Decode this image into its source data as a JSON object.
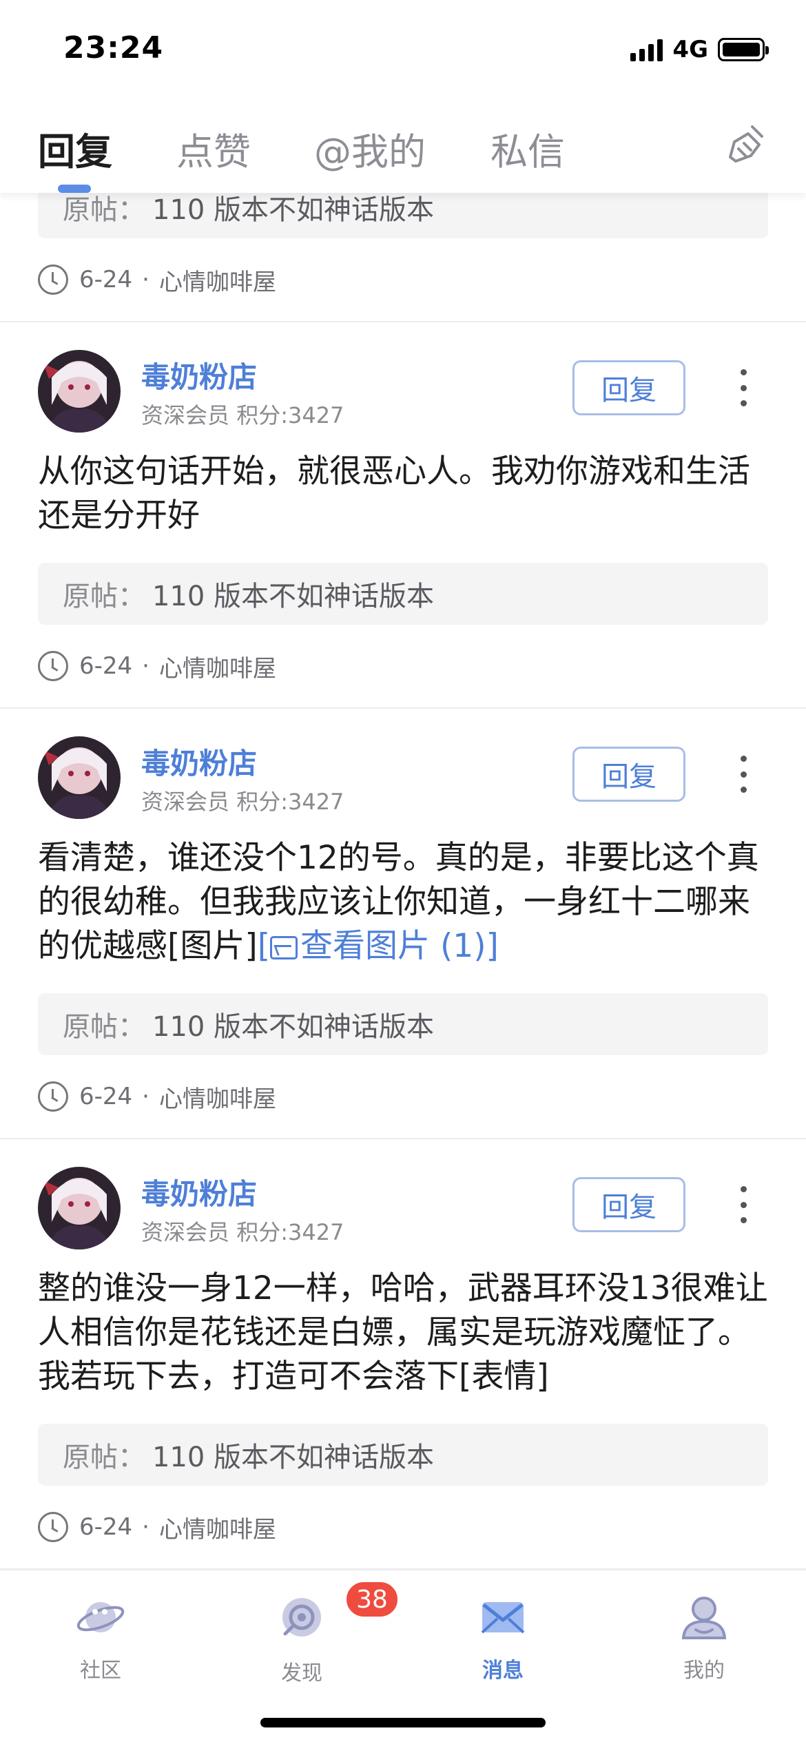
{
  "status_bar": {
    "time": "23:24",
    "network": "4G"
  },
  "tabs": [
    {
      "label": "回复",
      "active": true
    },
    {
      "label": "点赞",
      "active": false
    },
    {
      "label": "@我的",
      "active": false
    },
    {
      "label": "私信",
      "active": false
    }
  ],
  "feed": {
    "partial_top": {
      "origin_label": "原帖：",
      "origin_title": "110 版本不如神话版本",
      "date": "6-24",
      "forum": "心情咖啡屋"
    },
    "posts": [
      {
        "username": "毒奶粉店",
        "level": "资深会员",
        "score": "积分:3427",
        "reply_label": "回复",
        "content": "从你这句话开始，就很恶心人。我劝你游戏和生活还是分开好",
        "origin_label": "原帖：",
        "origin_title": "110 版本不如神话版本",
        "date": "6-24",
        "forum": "心情咖啡屋"
      },
      {
        "username": "毒奶粉店",
        "level": "资深会员",
        "score": "积分:3427",
        "reply_label": "回复",
        "content": "看清楚，谁还没个12的号。真的是，非要比这个真的很幼稚。但我我应该让你知道，一身红十二哪来的优越感[图片]",
        "link_prefix": "[",
        "link_text": "查看图片 (1)]",
        "origin_label": "原帖：",
        "origin_title": "110 版本不如神话版本",
        "date": "6-24",
        "forum": "心情咖啡屋"
      },
      {
        "username": "毒奶粉店",
        "level": "资深会员",
        "score": "积分:3427",
        "reply_label": "回复",
        "content": "整的谁没一身12一样，哈哈，武器耳环没13很难让人相信你是花钱还是白嫖，属实是玩游戏魔怔了。我若玩下去，打造可不会落下[表情]",
        "origin_label": "原帖：",
        "origin_title": "110 版本不如神话版本",
        "date": "6-24",
        "forum": "心情咖啡屋"
      }
    ]
  },
  "bottom_nav": [
    {
      "label": "社区",
      "icon": "planet-icon",
      "active": false
    },
    {
      "label": "发现",
      "icon": "discover-icon",
      "active": false,
      "badge": "38"
    },
    {
      "label": "消息",
      "icon": "mail-icon",
      "active": true
    },
    {
      "label": "我的",
      "icon": "profile-icon",
      "active": false
    }
  ],
  "colors": {
    "accent": "#4e7fd8",
    "badge": "#ef4b3f"
  }
}
